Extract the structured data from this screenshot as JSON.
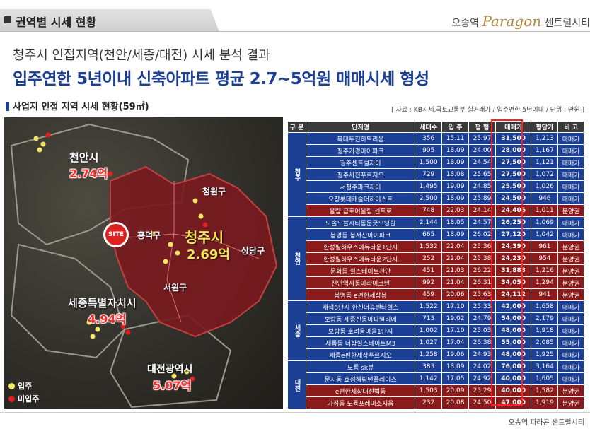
{
  "header": {
    "title": "권역별 시세 현황",
    "brand_prefix": "오송역",
    "brand_name": "Paragon",
    "brand_suffix": "센트럴시티"
  },
  "subtitle": "청주시 인접지역(천안/세종/대전) 시세 분석 결과",
  "headline": "입주연한 5년이내 신축아파트 평균  2.7~5억원 매매시세 형성",
  "section_title": "사업지 인접 지역 시세 현황(59㎡)",
  "source_note": "[ 자료 : KB시세,국토교통부 실거래가 / 입주연한 5년이내 / 단위 : 만원 ]",
  "map": {
    "cheonan": {
      "name": "천안시",
      "value": "2.74억"
    },
    "cheongju": {
      "name": "청주시",
      "value": "2.69억"
    },
    "sejong": {
      "name": "세종특별자치시",
      "value": "4.94억"
    },
    "daejeon": {
      "name": "대전광역시",
      "value": "5.07억"
    },
    "districts": {
      "cheongwon": "청원구",
      "heungdeok": "흥덕구",
      "sangdang": "상당구",
      "seowon": "서원구"
    },
    "site_label": "SITE",
    "legend_done": "입주",
    "legend_plan": "미입주",
    "colors": {
      "done": "#f5e663",
      "plan": "#e01f1f",
      "cheongju_area": "#7a1a1f"
    }
  },
  "table": {
    "headers": [
      "구 분",
      "단지명",
      "세대수",
      "입 주",
      "평 형",
      "매매가",
      "평당가",
      "비 고"
    ],
    "regions": [
      {
        "name": "청주",
        "rows": [
          [
            "복대두진하트리움",
            "356",
            "15.11",
            "25.97",
            "31,500",
            "1,213",
            "매매가"
          ],
          [
            "청주가경아이파크",
            "905",
            "18.09",
            "24.00",
            "28,000",
            "1,167",
            "매매가"
          ],
          [
            "청주센트럴자이",
            "1,500",
            "18.09",
            "24.54",
            "27,500",
            "1,121",
            "매매가"
          ],
          [
            "청주사천푸르지오",
            "729",
            "18.08",
            "25.65",
            "27,500",
            "1,072",
            "매매가"
          ],
          [
            "서청주파크자이",
            "1,495",
            "19.09",
            "24.85",
            "25,500",
            "1,026",
            "매매가"
          ],
          [
            "오창롯데캐슬더하이스트",
            "2,500",
            "18.09",
            "25.89",
            "24,500",
            "946",
            "매매가"
          ],
          [
            "율량 금호어울림 센트로",
            "748",
            "22.03",
            "24.14",
            "24,406",
            "1,011",
            "분양권"
          ]
        ]
      },
      {
        "name": "천안",
        "rows": [
          [
            "도솔노블시티동문굿모닝힐",
            "2,144",
            "18.05",
            "24.57",
            "26,250",
            "1,069",
            "매매가"
          ],
          [
            "봉명동 봉서산아이파크",
            "665",
            "18.09",
            "26.02",
            "27,120",
            "1,042",
            "매매가"
          ],
          [
            "한성필하우스에듀타운1단지",
            "1,532",
            "22.04",
            "25.36",
            "24,390",
            "961",
            "분양권"
          ],
          [
            "한성필하우스에듀타운2단지",
            "252",
            "22.04",
            "25.38",
            "24,230",
            "954",
            "분양권"
          ],
          [
            "문화동 힐스테이트천안",
            "451",
            "21.03",
            "26.22",
            "31,883",
            "1,216",
            "분양권"
          ],
          [
            "천안역사동아라이크텐",
            "992",
            "21.04",
            "26.31",
            "34,050",
            "1,294",
            "분양권"
          ],
          [
            "봉명동 e편한세상봉",
            "459",
            "20.06",
            "25.63",
            "24,112",
            "941",
            "분양권"
          ]
        ]
      },
      {
        "name": "세종",
        "rows": [
          [
            "새샘6단지 한신더휴펜타힐스",
            "1,522",
            "17.10",
            "25.33",
            "42,000",
            "1,658",
            "매매가"
          ],
          [
            "보람동 세종신동아파밀리에",
            "713",
            "19.02",
            "24.79",
            "54,000",
            "2,179",
            "매매가"
          ],
          [
            "보람동 호려울마을1단지",
            "1,002",
            "17.10",
            "25.03",
            "48,000",
            "1,918",
            "매매가"
          ],
          [
            "새롬동 더샵힐스테이트M3",
            "1,027",
            "17.04",
            "26.38",
            "55,000",
            "2,085",
            "매매가"
          ],
          [
            "세종e편한세상푸르지오",
            "1,258",
            "19.06",
            "24.93",
            "48,000",
            "1,925",
            "매매가"
          ]
        ]
      },
      {
        "name": "대전",
        "rows": [
          [
            "도룡 sk뷰",
            "383",
            "18.09",
            "24.02",
            "76,000",
            "3,164",
            "매매가"
          ],
          [
            "문지동 효성해링턴플레이스",
            "1,142",
            "17.05",
            "24.92",
            "40,000",
            "1,605",
            "매매가"
          ],
          [
            "e편한세상대전법동",
            "1,503",
            "20.09",
            "25.29",
            "40,000",
            "1,582",
            "분양권"
          ],
          [
            "가정동 도룡포레미소지움",
            "232",
            "20.08",
            "24.50",
            "47,000",
            "1,919",
            "분양권"
          ]
        ]
      }
    ]
  },
  "footer": "오송역 파라곤 센트럴시티"
}
